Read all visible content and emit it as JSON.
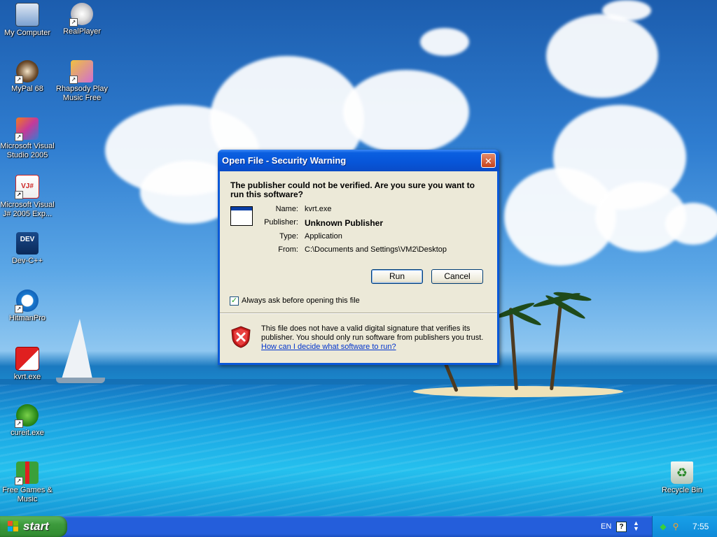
{
  "desktop": {
    "icons": [
      {
        "label": "My Computer",
        "icon": "computer-icon"
      },
      {
        "label": "RealPlayer",
        "icon": "realplayer-icon"
      },
      {
        "label": "MyPal 68",
        "icon": "mypal-icon"
      },
      {
        "label": "Rhapsody Play Music Free",
        "icon": "rhapsody-icon"
      },
      {
        "label": "Microsoft Visual Studio 2005",
        "icon": "visual-studio-icon"
      },
      {
        "label": "Microsoft Visual J# 2005 Exp...",
        "icon": "visual-jsharp-icon"
      },
      {
        "label": "Dev-C++",
        "icon": "devcpp-icon"
      },
      {
        "label": "HitmanPro",
        "icon": "hitmanpro-icon"
      },
      {
        "label": "kvrt.exe",
        "icon": "kvrt-icon"
      },
      {
        "label": "cureit.exe",
        "icon": "cureit-icon"
      },
      {
        "label": "Free Games & Music",
        "icon": "gift-icon"
      },
      {
        "label": "Recycle Bin",
        "icon": "recycle-bin-icon"
      }
    ]
  },
  "dialog": {
    "title": "Open File - Security Warning",
    "close_glyph": "✕",
    "question": "The publisher could not be verified.  Are you sure you want to run this software?",
    "fields": {
      "name_label": "Name:",
      "name_value": "kvrt.exe",
      "publisher_label": "Publisher:",
      "publisher_value": "Unknown Publisher",
      "type_label": "Type:",
      "type_value": "Application",
      "from_label": "From:",
      "from_value": "C:\\Documents and Settings\\VM2\\Desktop"
    },
    "run_label": "Run",
    "cancel_label": "Cancel",
    "checkbox_label": "Always ask before opening this file",
    "checkbox_checked": true,
    "checkbox_glyph": "✓",
    "warning_text": "This file does not have a valid digital signature that verifies its publisher.  You should only run software from publishers you trust.",
    "help_link": "How can I decide what software to run?"
  },
  "taskbar": {
    "start_label": "start",
    "language": "EN",
    "help_glyph": "?",
    "clock": "7:55"
  },
  "colors": {
    "titlebar": "#0a5fe0",
    "dialog_bg": "#ece9d8",
    "taskbar": "#245edb",
    "start_button": "#3c9a3c",
    "link": "#0033cc"
  }
}
